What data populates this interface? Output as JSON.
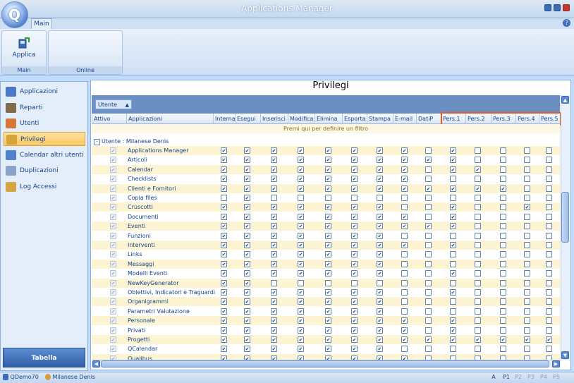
{
  "window": {
    "title": "Applications Manager"
  },
  "ribbon": {
    "tab": "Main",
    "apply_label": "Applica",
    "groups": [
      "Main",
      "Online"
    ]
  },
  "sidebar": {
    "items": [
      {
        "label": "Applicazioni",
        "icon": "applications-icon",
        "color": "#4a79c8"
      },
      {
        "label": "Reparti",
        "icon": "departments-icon",
        "color": "#7f6a4a"
      },
      {
        "label": "Utenti",
        "icon": "users-icon",
        "color": "#d1783a"
      },
      {
        "label": "Privilegi",
        "icon": "keys-icon",
        "color": "#d8a43a",
        "selected": true
      },
      {
        "label": "Calendar altri utenti",
        "icon": "calendar-icon",
        "color": "#4f83cc"
      },
      {
        "label": "Duplicazioni",
        "icon": "duplicate-icon",
        "color": "#8aa3c8"
      },
      {
        "label": "Log Accessi",
        "icon": "lock-icon",
        "color": "#d4a642"
      }
    ],
    "bottom_label": "Tabella"
  },
  "content": {
    "title": "Privilegi",
    "group_chip": "Utente",
    "filter_hint": "Premi qui per definire un filtro",
    "user_group": "Utente : Milanese Denis",
    "columns": [
      "Attivo",
      "Applicazioni",
      "Interna",
      "Esegui",
      "Inserisci",
      "Modifica",
      "Elimina",
      "Esporta",
      "Stampa",
      "E-mail",
      "DatiP",
      "Pers.1",
      "Pers.2",
      "Pers.3",
      "Pers.4",
      "Pers.5"
    ],
    "rows": [
      {
        "app": "Applications Manager",
        "perms": [
          1,
          1,
          1,
          1,
          1,
          1,
          1,
          1,
          0,
          1,
          0,
          0,
          0,
          0
        ]
      },
      {
        "app": "Articoli",
        "perms": [
          1,
          1,
          1,
          1,
          1,
          1,
          1,
          1,
          1,
          1,
          0,
          0,
          0,
          0
        ]
      },
      {
        "app": "Calendar",
        "perms": [
          1,
          1,
          1,
          1,
          1,
          1,
          1,
          1,
          0,
          1,
          1,
          0,
          0,
          0
        ]
      },
      {
        "app": "Checklists",
        "perms": [
          1,
          1,
          1,
          1,
          1,
          1,
          1,
          1,
          0,
          0,
          0,
          0,
          0,
          0
        ]
      },
      {
        "app": "Clienti e Fornitori",
        "perms": [
          1,
          1,
          1,
          1,
          1,
          1,
          1,
          1,
          1,
          1,
          1,
          1,
          0,
          0
        ]
      },
      {
        "app": "Copia files",
        "perms": [
          0,
          1,
          0,
          0,
          0,
          0,
          0,
          0,
          0,
          0,
          0,
          0,
          0,
          0
        ]
      },
      {
        "app": "Cruscotti",
        "perms": [
          1,
          1,
          1,
          1,
          1,
          1,
          1,
          0,
          0,
          1,
          0,
          0,
          1,
          0
        ]
      },
      {
        "app": "Documenti",
        "perms": [
          1,
          1,
          1,
          1,
          1,
          1,
          1,
          1,
          0,
          1,
          0,
          0,
          0,
          0
        ]
      },
      {
        "app": "Eventi",
        "perms": [
          1,
          1,
          1,
          1,
          1,
          1,
          1,
          1,
          1,
          1,
          0,
          0,
          0,
          0
        ]
      },
      {
        "app": "Funzioni",
        "perms": [
          1,
          1,
          1,
          1,
          1,
          1,
          1,
          0,
          0,
          0,
          0,
          0,
          0,
          0
        ]
      },
      {
        "app": "Interventi",
        "perms": [
          1,
          1,
          1,
          1,
          1,
          1,
          1,
          1,
          0,
          1,
          0,
          0,
          0,
          0
        ]
      },
      {
        "app": "Links",
        "perms": [
          1,
          1,
          1,
          1,
          1,
          1,
          1,
          0,
          0,
          0,
          0,
          0,
          0,
          0
        ]
      },
      {
        "app": "Messaggi",
        "perms": [
          1,
          1,
          1,
          1,
          1,
          1,
          1,
          0,
          0,
          0,
          0,
          0,
          0,
          0
        ]
      },
      {
        "app": "Modelli Eventi",
        "perms": [
          1,
          1,
          1,
          1,
          1,
          1,
          1,
          0,
          0,
          1,
          0,
          0,
          0,
          0
        ]
      },
      {
        "app": "NewKeyGenerator",
        "perms": [
          1,
          1,
          0,
          0,
          0,
          0,
          0,
          0,
          0,
          0,
          0,
          0,
          0,
          0
        ]
      },
      {
        "app": "Obiettivi, Indicatori e Traguardi",
        "perms": [
          1,
          1,
          1,
          1,
          1,
          1,
          1,
          0,
          0,
          1,
          0,
          0,
          0,
          0
        ]
      },
      {
        "app": "Organigrammi",
        "perms": [
          1,
          1,
          1,
          1,
          1,
          1,
          1,
          0,
          0,
          0,
          0,
          0,
          0,
          0
        ]
      },
      {
        "app": "Parametri Valutazione",
        "perms": [
          1,
          1,
          1,
          1,
          1,
          1,
          1,
          0,
          0,
          0,
          0,
          0,
          0,
          0
        ]
      },
      {
        "app": "Personale",
        "perms": [
          1,
          1,
          1,
          1,
          1,
          1,
          1,
          1,
          0,
          1,
          0,
          0,
          0,
          0
        ]
      },
      {
        "app": "Privati",
        "perms": [
          1,
          1,
          1,
          1,
          1,
          1,
          1,
          1,
          0,
          1,
          0,
          0,
          0,
          0
        ]
      },
      {
        "app": "Progetti",
        "perms": [
          1,
          1,
          1,
          1,
          1,
          1,
          1,
          1,
          1,
          1,
          1,
          1,
          1,
          1
        ]
      },
      {
        "app": "QCalendar",
        "perms": [
          1,
          1,
          1,
          1,
          1,
          1,
          1,
          0,
          0,
          0,
          0,
          0,
          0,
          0
        ]
      },
      {
        "app": "Qualibus",
        "perms": [
          1,
          1,
          1,
          1,
          1,
          1,
          1,
          1,
          0,
          0,
          0,
          0,
          0,
          0
        ]
      }
    ]
  },
  "statusbar": {
    "db": "QDemo70",
    "user": "Milanese Denis",
    "keys": [
      "A",
      "P1",
      "P2",
      "P3",
      "P4",
      "P5"
    ]
  },
  "colors": {
    "highlight": "#e55b1f",
    "selected_nav": "#f9c864"
  }
}
